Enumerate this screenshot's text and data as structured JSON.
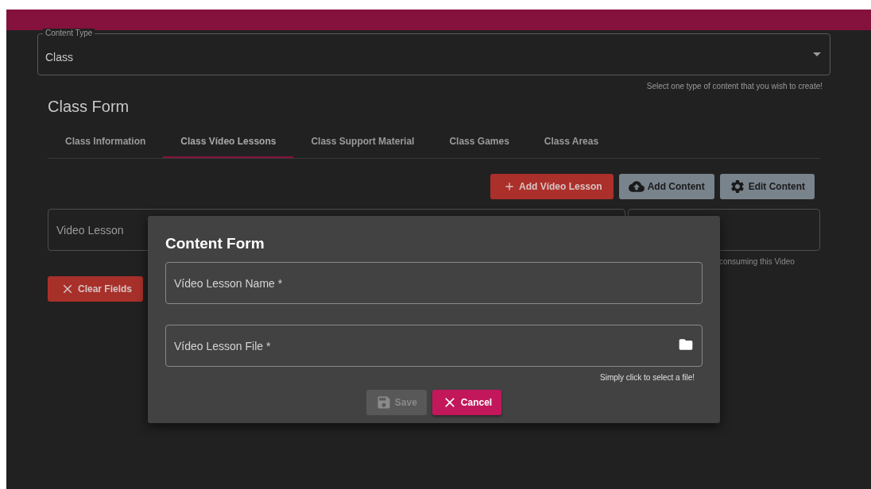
{
  "content_type": {
    "label": "Content Type",
    "value": "Class",
    "hint": "Select one type of content that you wish to create!"
  },
  "form_title": "Class Form",
  "tabs": [
    {
      "label": "Class Information",
      "selected": false
    },
    {
      "label": "Class Vídeo Lessons",
      "selected": true
    },
    {
      "label": "Class Support Material",
      "selected": false
    },
    {
      "label": "Class Games",
      "selected": false
    },
    {
      "label": "Class Areas",
      "selected": false
    }
  ],
  "toolbar_buttons": [
    {
      "label": "Add Vídeo Lesson",
      "kind": "add"
    },
    {
      "label": "Add Content",
      "kind": "upload"
    },
    {
      "label": "Edit Content",
      "kind": "edit"
    }
  ],
  "lesson_fields": [
    {
      "placeholder": "Video Lesson"
    },
    {
      "hint": "consuming this Video"
    }
  ],
  "clear_button": {
    "label": "Clear Fields"
  },
  "dialog": {
    "title": "Content Form",
    "fields": [
      {
        "placeholder": "Vídeo Lesson Name *",
        "kind": "text"
      },
      {
        "placeholder": "Vídeo Lesson File *",
        "kind": "file",
        "hint": "Simply click to select a file!"
      }
    ],
    "buttons": [
      {
        "label": "Save",
        "kind": "save",
        "disabled": true
      },
      {
        "label": "Cancel",
        "kind": "cancel",
        "disabled": false
      }
    ]
  }
}
